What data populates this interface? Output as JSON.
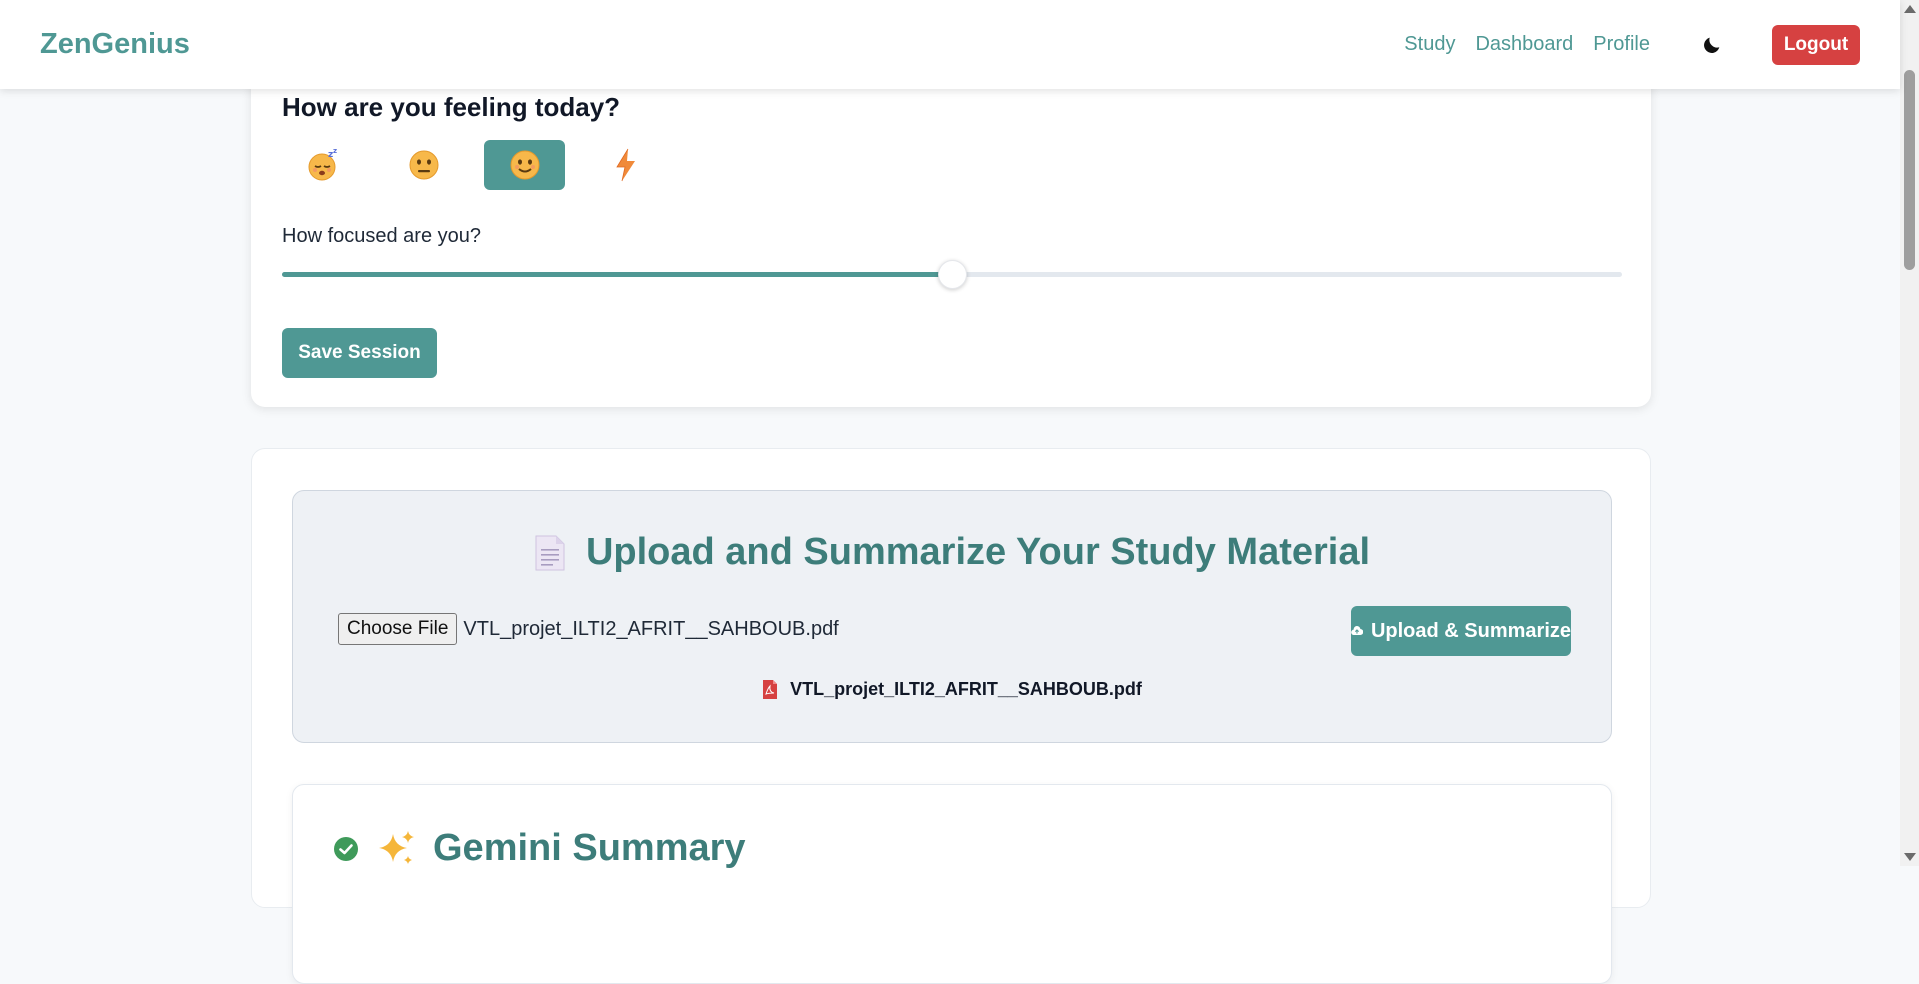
{
  "navbar": {
    "brand": "ZenGenius",
    "links": [
      "Study",
      "Dashboard",
      "Profile"
    ],
    "logout_label": "Logout"
  },
  "mood": {
    "title": "How are you feeling today?",
    "options": [
      "sleepy-face-icon",
      "neutral-face-icon",
      "smiling-face-icon",
      "lightning-icon"
    ],
    "selected_index": 2,
    "focus_label": "How focused are you?",
    "focus_value_fraction": 0.5,
    "save_label": "Save Session"
  },
  "upload": {
    "title": "Upload and Summarize Your Study Material",
    "choose_file_label": "Choose File",
    "file_name": "VTL_projet_ILTI2_AFRIT__SAHBOUB.pdf",
    "upload_button_label": "Upload & Summarize",
    "uploaded_file_name": "VTL_projet_ILTI2_AFRIT__SAHBOUB.pdf"
  },
  "summary": {
    "title": "Gemini Summary"
  },
  "colors": {
    "accent": "#4f9894",
    "heading_accent": "#3d7d7a",
    "danger": "#d64141"
  }
}
